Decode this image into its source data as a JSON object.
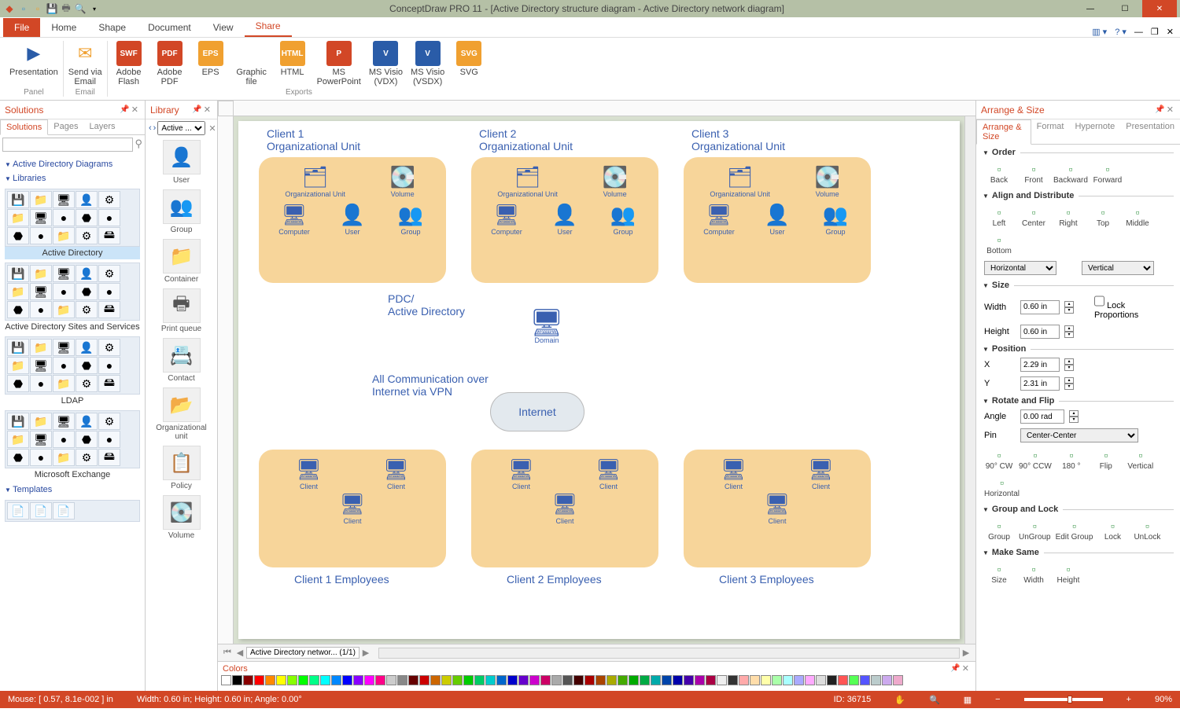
{
  "title": "ConceptDraw PRO 11 - [Active Directory structure diagram - Active Directory network diagram]",
  "ribbon": {
    "tabs": [
      "File",
      "Home",
      "Shape",
      "Document",
      "View",
      "Share"
    ],
    "active": "Share",
    "groups": {
      "panel": {
        "label": "Panel",
        "items": [
          {
            "label": "Presentation",
            "icon": "▶"
          }
        ]
      },
      "email": {
        "label": "Email",
        "items": [
          {
            "label": "Send via\nEmail",
            "icon": "✉"
          }
        ]
      },
      "exports": {
        "label": "Exports",
        "items": [
          {
            "label": "Adobe\nFlash",
            "icon": "SWF",
            "bg": "#d24726"
          },
          {
            "label": "Adobe\nPDF",
            "icon": "PDF",
            "bg": "#d24726"
          },
          {
            "label": "EPS",
            "icon": "EPS",
            "bg": "#f0a030"
          },
          {
            "label": "Graphic\nfile",
            "icon": "🖼",
            "bg": "#fff"
          },
          {
            "label": "HTML",
            "icon": "HTML",
            "bg": "#f0a030"
          },
          {
            "label": "MS\nPowerPoint",
            "icon": "P",
            "bg": "#d24726"
          },
          {
            "label": "MS Visio\n(VDX)",
            "icon": "V",
            "bg": "#2a5ca8"
          },
          {
            "label": "MS Visio\n(VSDX)",
            "icon": "V",
            "bg": "#2a5ca8"
          },
          {
            "label": "SVG",
            "icon": "SVG",
            "bg": "#f0a030"
          }
        ]
      }
    }
  },
  "solutions": {
    "title": "Solutions",
    "tabs": [
      "Solutions",
      "Pages",
      "Layers"
    ],
    "active_tab": "Solutions",
    "nodes": [
      "Active Directory Diagrams",
      "Libraries",
      "Templates"
    ],
    "libraries": [
      {
        "name": "Active Directory",
        "selected": true
      },
      {
        "name": "Active Directory Sites and Services"
      },
      {
        "name": "LDAP"
      },
      {
        "name": "Microsoft Exchange"
      }
    ]
  },
  "library": {
    "title": "Library",
    "selector": "Active ...",
    "items": [
      "User",
      "Group",
      "Container",
      "Print queue",
      "Contact",
      "Organizational unit",
      "Policy",
      "Volume"
    ]
  },
  "canvas": {
    "tabs_label": "Active Directory networ... (1/1)",
    "colors_title": "Colors",
    "diagram": {
      "units": [
        {
          "title": "Client 1",
          "sub": "Organizational Unit"
        },
        {
          "title": "Client 2",
          "sub": "Organizational Unit"
        },
        {
          "title": "Client 3",
          "sub": "Organizational Unit"
        }
      ],
      "unit_items": [
        "Organizational Unit",
        "Volume",
        "Computer",
        "User",
        "Group"
      ],
      "pdc": "PDC/\nActive Directory",
      "domain": "Domain",
      "vpn": "All Communication over\nInternet via VPN",
      "internet": "Internet",
      "client_label": "Client",
      "employees": [
        "Client 1 Employees",
        "Client 2 Employees",
        "Client 3 Employees"
      ]
    }
  },
  "arrange": {
    "title": "Arrange & Size",
    "tabs": [
      "Arrange & Size",
      "Format",
      "Hypernote",
      "Presentation"
    ],
    "order": {
      "title": "Order",
      "items": [
        "Back",
        "Front",
        "Backward",
        "Forward"
      ]
    },
    "align": {
      "title": "Align and Distribute",
      "items": [
        "Left",
        "Center",
        "Right",
        "Top",
        "Middle",
        "Bottom"
      ],
      "h": "Horizontal",
      "v": "Vertical"
    },
    "size": {
      "title": "Size",
      "width_label": "Width",
      "height_label": "Height",
      "width": "0.60 in",
      "height": "0.60 in",
      "lock": "Lock Proportions"
    },
    "position": {
      "title": "Position",
      "x_label": "X",
      "y_label": "Y",
      "x": "2.29 in",
      "y": "2.31 in"
    },
    "rotate": {
      "title": "Rotate and Flip",
      "angle_label": "Angle",
      "angle": "0.00 rad",
      "pin_label": "Pin",
      "pin": "Center-Center",
      "items": [
        "90° CW",
        "90° CCW",
        "180 °",
        "Flip",
        "Vertical",
        "Horizontal"
      ]
    },
    "grouplock": {
      "title": "Group and Lock",
      "items": [
        "Group",
        "UnGroup",
        "Edit Group",
        "Lock",
        "UnLock"
      ]
    },
    "makesame": {
      "title": "Make Same",
      "items": [
        "Size",
        "Width",
        "Height"
      ]
    }
  },
  "status": {
    "mouse": "Mouse: [ 0.57, 8.1e-002 ] in",
    "dims": "Width: 0.60 in;  Height: 0.60 in;  Angle: 0.00°",
    "id": "ID: 36715",
    "zoom": "90%"
  }
}
